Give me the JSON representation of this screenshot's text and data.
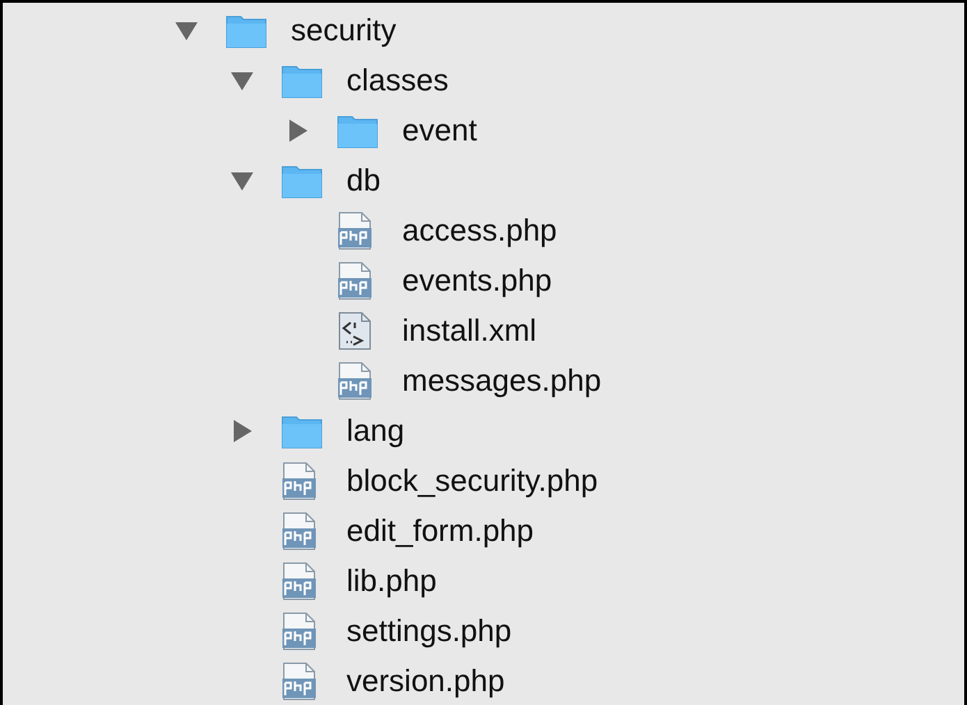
{
  "tree": [
    {
      "name": "security",
      "kind": "folder",
      "expanded": true,
      "children": [
        {
          "name": "classes",
          "kind": "folder",
          "expanded": true,
          "children": [
            {
              "name": "event",
              "kind": "folder",
              "expanded": false
            }
          ]
        },
        {
          "name": "db",
          "kind": "folder",
          "expanded": true,
          "children": [
            {
              "name": "access.php",
              "kind": "php"
            },
            {
              "name": "events.php",
              "kind": "php"
            },
            {
              "name": "install.xml",
              "kind": "xml"
            },
            {
              "name": "messages.php",
              "kind": "php"
            }
          ]
        },
        {
          "name": "lang",
          "kind": "folder",
          "expanded": false
        },
        {
          "name": "block_security.php",
          "kind": "php"
        },
        {
          "name": "edit_form.php",
          "kind": "php"
        },
        {
          "name": "lib.php",
          "kind": "php"
        },
        {
          "name": "settings.php",
          "kind": "php"
        },
        {
          "name": "version.php",
          "kind": "php"
        }
      ]
    }
  ]
}
